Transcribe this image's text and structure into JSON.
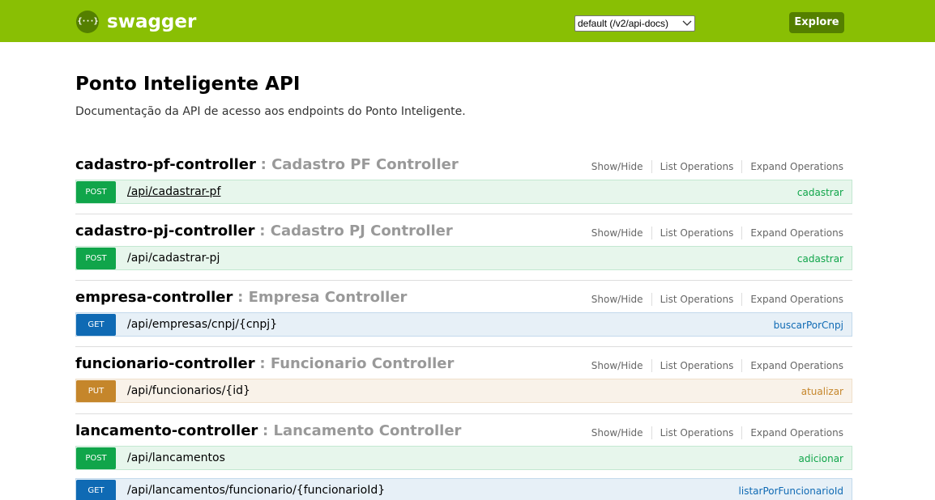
{
  "header": {
    "brand": "swagger",
    "logo_text": "{···}",
    "spec_select": "default (/v2/api-docs)",
    "explore_label": "Explore",
    "bar_color": "#89bf04",
    "accent_color": "#547f00"
  },
  "info": {
    "title": "Ponto Inteligente API",
    "description": "Documentação da API de acesso aos endpoints do Ponto Inteligente."
  },
  "resource_links": [
    "Show/Hide",
    "List Operations",
    "Expand Operations"
  ],
  "resources": [
    {
      "name": "cadastro-pf-controller",
      "description": ": Cadastro PF Controller",
      "operations": [
        {
          "method": "POST",
          "path": "/api/cadastrar-pf",
          "nickname": "cadastrar"
        }
      ]
    },
    {
      "name": "cadastro-pj-controller",
      "description": ": Cadastro PJ Controller",
      "operations": [
        {
          "method": "POST",
          "path": "/api/cadastrar-pj",
          "nickname": "cadastrar"
        }
      ]
    },
    {
      "name": "empresa-controller",
      "description": ": Empresa Controller",
      "operations": [
        {
          "method": "GET",
          "path": "/api/empresas/cnpj/{cnpj}",
          "nickname": "buscarPorCnpj"
        }
      ]
    },
    {
      "name": "funcionario-controller",
      "description": ": Funcionario Controller",
      "operations": [
        {
          "method": "PUT",
          "path": "/api/funcionarios/{id}",
          "nickname": "atualizar"
        }
      ]
    },
    {
      "name": "lancamento-controller",
      "description": ": Lancamento Controller",
      "operations": [
        {
          "method": "POST",
          "path": "/api/lancamentos",
          "nickname": "adicionar"
        },
        {
          "method": "GET",
          "path": "/api/lancamentos/funcionario/{funcionarioId}",
          "nickname": "listarPorFuncionarioId"
        }
      ]
    }
  ],
  "method_colors": {
    "POST": "#10a54a",
    "GET": "#0f6ab4",
    "PUT": "#c5862b"
  }
}
